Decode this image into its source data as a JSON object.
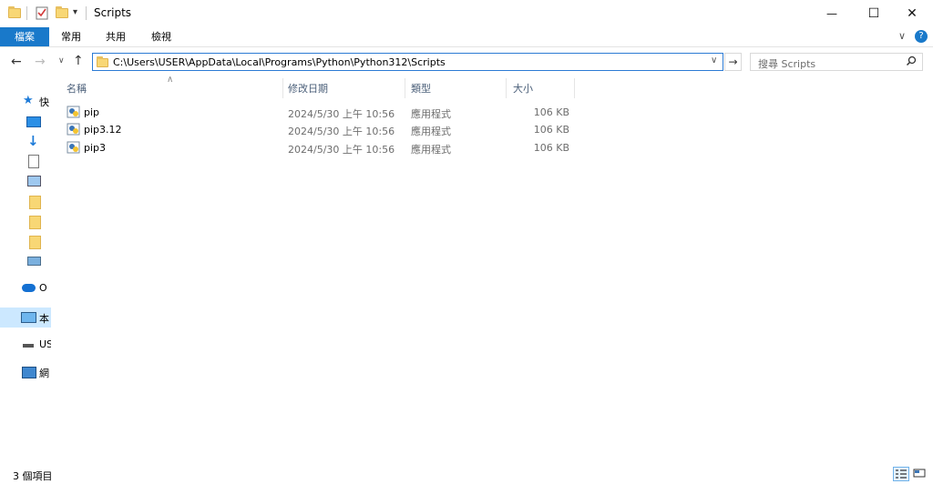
{
  "window": {
    "title": "Scripts",
    "minimize_glyph": "—",
    "maximize_glyph": "☐",
    "close_glyph": "✕"
  },
  "ribbon": {
    "tabs": [
      "檔案",
      "常用",
      "共用",
      "檢視"
    ],
    "file_color": "#1979ca"
  },
  "address": {
    "path": "C:\\Users\\USER\\AppData\\Local\\Programs\\Python\\Python312\\Scripts"
  },
  "search": {
    "placeholder": "搜尋 Scripts"
  },
  "columns": {
    "name": "名稱",
    "modified": "修改日期",
    "type": "類型",
    "size": "大小"
  },
  "files": [
    {
      "name": "pip",
      "modified": "2024/5/30 上午 10:56",
      "type": "應用程式",
      "size": "106 KB"
    },
    {
      "name": "pip3.12",
      "modified": "2024/5/30 上午 10:56",
      "type": "應用程式",
      "size": "106 KB"
    },
    {
      "name": "pip3",
      "modified": "2024/5/30 上午 10:56",
      "type": "應用程式",
      "size": "106 KB"
    }
  ],
  "nav": {
    "quick_access": "快",
    "desktop": "",
    "downloads": "",
    "documents": "",
    "pictures": "",
    "folder1": "",
    "folder2": "",
    "folder3": "",
    "network_drive": "",
    "onedrive": "O",
    "this_pc": "本",
    "usb": "US",
    "network": "網"
  },
  "status": {
    "item_count": "3 個項目"
  },
  "colors": {
    "accent": "#1979ca",
    "header_text": "#4c607a",
    "selected_nav": "#cce8ff"
  }
}
